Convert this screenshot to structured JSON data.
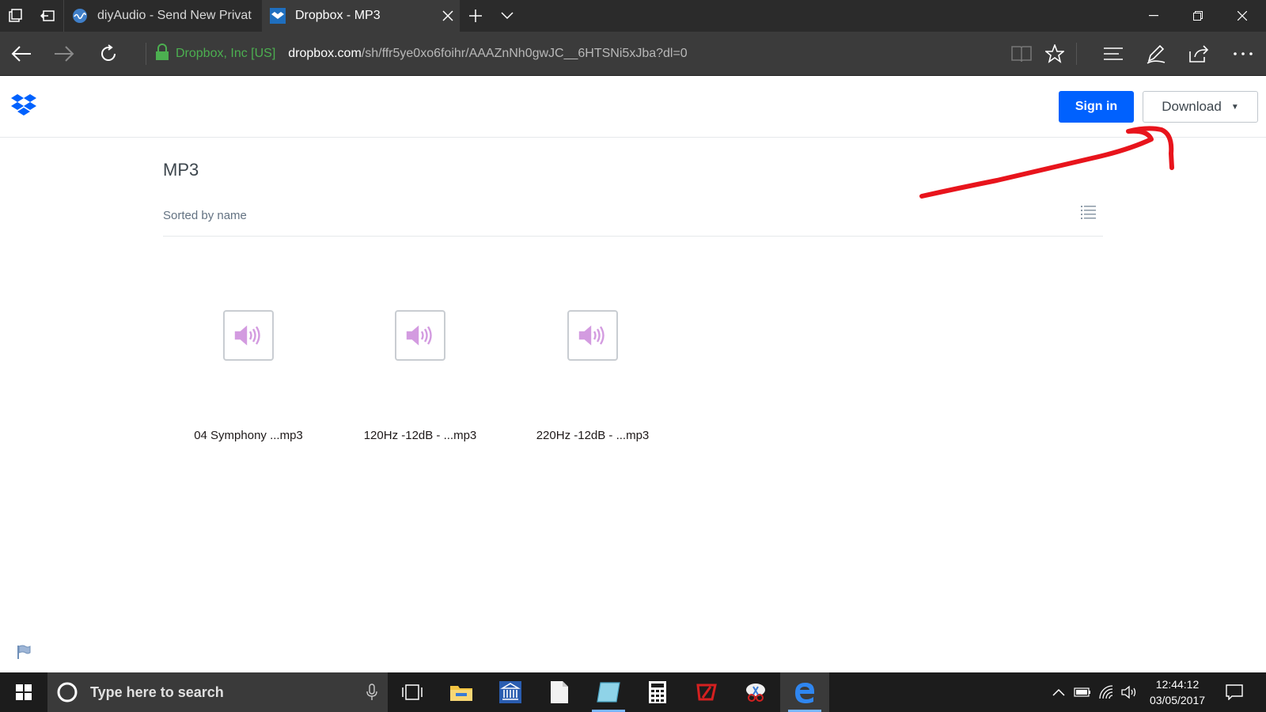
{
  "browser": {
    "tabs": [
      {
        "title": "diyAudio - Send New Privat",
        "active": false,
        "favicon": "diyaudio-icon"
      },
      {
        "title": "Dropbox - MP3",
        "active": true,
        "favicon": "dropbox-favicon"
      }
    ],
    "certificate": "Dropbox, Inc [US]",
    "url_host": "dropbox.com",
    "url_path": "/sh/ffr5ye0xo6foihr/AAAZnNh0gwJC__6HTSNi5xJba?dl=0"
  },
  "page": {
    "header": {
      "sign_in_label": "Sign in",
      "download_label": "Download"
    },
    "folder_title": "MP3",
    "sort_label": "Sorted by name",
    "files": [
      {
        "name": "04 Symphony ...mp3",
        "icon": "audio-file-icon"
      },
      {
        "name": "120Hz -12dB - ...mp3",
        "icon": "audio-file-icon"
      },
      {
        "name": "220Hz -12dB - ...mp3",
        "icon": "audio-file-icon"
      }
    ]
  },
  "taskbar": {
    "search_placeholder": "Type here to search",
    "time": "12:44:12",
    "date": "03/05/2017"
  },
  "colors": {
    "primary_button": "#0061fe",
    "annotation": "#e8141c",
    "audio_icon": "#d39be0"
  }
}
